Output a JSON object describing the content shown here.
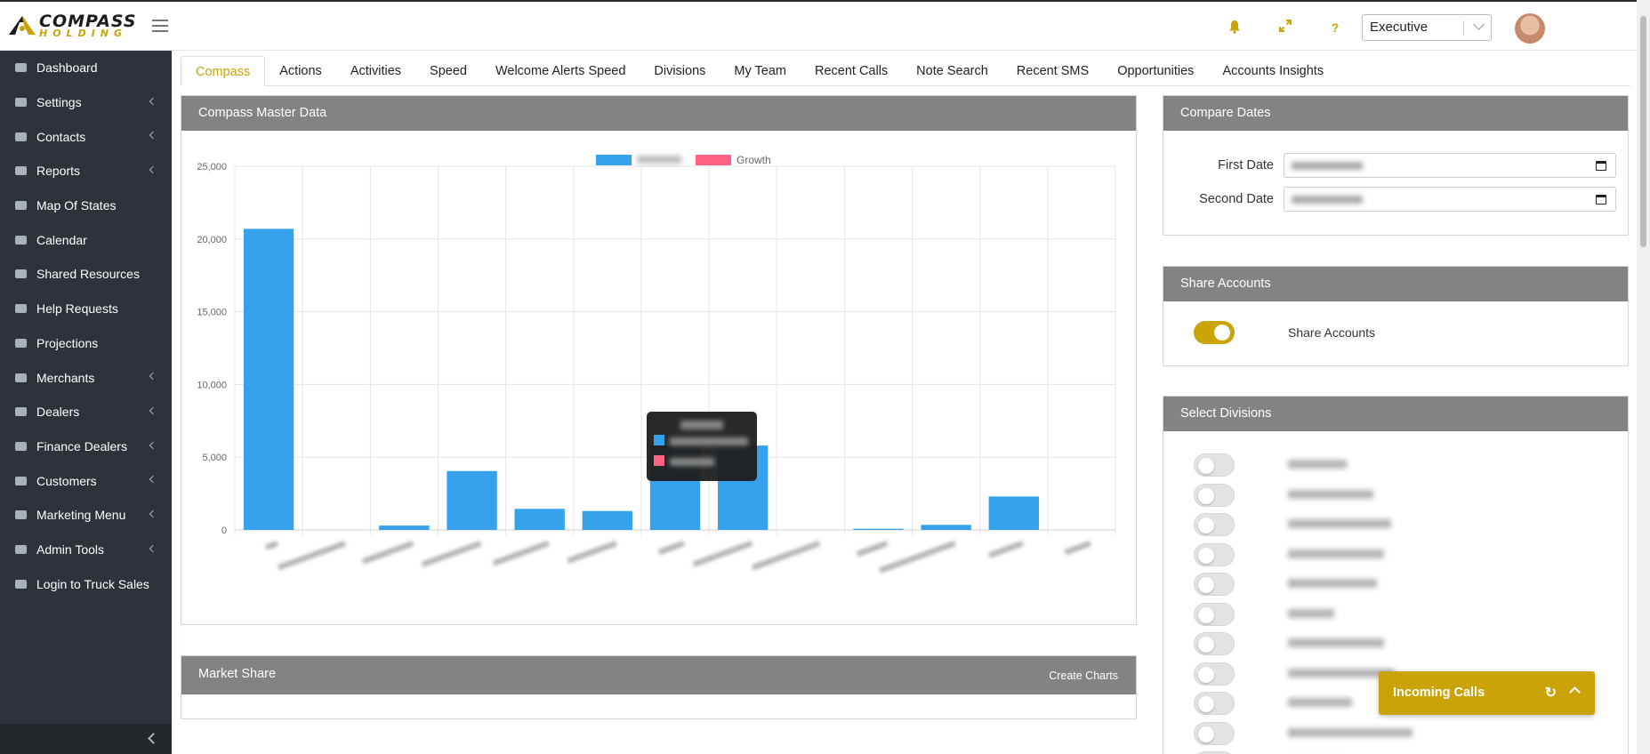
{
  "brand": {
    "name_line1": "COMPASS",
    "name_line2": "HOLDING",
    "accent": "#c9a307"
  },
  "header": {
    "icons": [
      "bell-icon",
      "expand-icon",
      "help-icon"
    ],
    "help_glyph": "?",
    "role_select": {
      "value": "Executive"
    }
  },
  "sidebar": {
    "items": [
      {
        "label": "Dashboard",
        "icon": "dashboard-icon",
        "expandable": false
      },
      {
        "label": "Settings",
        "icon": "gears-icon",
        "expandable": true
      },
      {
        "label": "Contacts",
        "icon": "address-card-icon",
        "expandable": true
      },
      {
        "label": "Reports",
        "icon": "bar-chart-icon",
        "expandable": true
      },
      {
        "label": "Map Of States",
        "icon": "map-icon",
        "expandable": false
      },
      {
        "label": "Calendar",
        "icon": "calendar-icon",
        "expandable": false
      },
      {
        "label": "Shared Resources",
        "icon": "folder-open-icon",
        "expandable": false
      },
      {
        "label": "Help Requests",
        "icon": "life-ring-icon",
        "expandable": false
      },
      {
        "label": "Projections",
        "icon": "dot-circle-icon",
        "expandable": false
      },
      {
        "label": "Merchants",
        "icon": "bank-icon",
        "expandable": true
      },
      {
        "label": "Dealers",
        "icon": "bank-icon",
        "expandable": true
      },
      {
        "label": "Finance Dealers",
        "icon": "bank-icon",
        "expandable": true
      },
      {
        "label": "Customers",
        "icon": "bank-icon",
        "expandable": true
      },
      {
        "label": "Marketing Menu",
        "icon": "newspaper-icon",
        "expandable": true
      },
      {
        "label": "Admin Tools",
        "icon": "wrench-icon",
        "expandable": true
      },
      {
        "label": "Login to Truck Sales",
        "icon": "truck-icon",
        "expandable": false
      }
    ]
  },
  "tabs": [
    {
      "label": "Compass",
      "active": true
    },
    {
      "label": "Actions"
    },
    {
      "label": "Activities"
    },
    {
      "label": "Speed"
    },
    {
      "label": "Welcome Alerts Speed"
    },
    {
      "label": "Divisions"
    },
    {
      "label": "My Team"
    },
    {
      "label": "Recent Calls"
    },
    {
      "label": "Note Search"
    },
    {
      "label": "Recent SMS"
    },
    {
      "label": "Opportunities"
    },
    {
      "label": "Accounts Insights"
    }
  ],
  "master_panel": {
    "title": "Compass Master Data"
  },
  "chart_data": {
    "type": "bar",
    "title": "",
    "categories": [
      "",
      "",
      "",
      "",
      "",
      "",
      "",
      "",
      "",
      "",
      "",
      "",
      ""
    ],
    "series": [
      {
        "name": "",
        "color": "#36a2eb",
        "values": [
          20700,
          0,
          300,
          4050,
          1450,
          1300,
          5800,
          5800,
          0,
          80,
          350,
          2300,
          0
        ]
      },
      {
        "name": "Growth",
        "color": "#ff6384",
        "values": [
          0,
          0,
          0,
          0,
          0,
          0,
          0,
          0,
          0,
          0,
          0,
          0,
          0
        ]
      }
    ],
    "ylim": [
      0,
      25000
    ],
    "yticks": [
      "0",
      "5,000",
      "10,000",
      "15,000",
      "20,000",
      "25,000"
    ],
    "legend": "top-center",
    "grid": true,
    "xlabel": "",
    "ylabel": ""
  },
  "market_panel": {
    "title": "Market Share",
    "action": "Create Charts"
  },
  "compare_panel": {
    "title": "Compare Dates",
    "first_label": "First Date",
    "second_label": "Second Date"
  },
  "share_panel": {
    "title": "Share Accounts",
    "toggle_label": "Share Accounts",
    "enabled": true
  },
  "divisions_panel": {
    "title": "Select Divisions",
    "toggle_count": 11
  },
  "incoming_calls": {
    "label": "Incoming Calls"
  }
}
